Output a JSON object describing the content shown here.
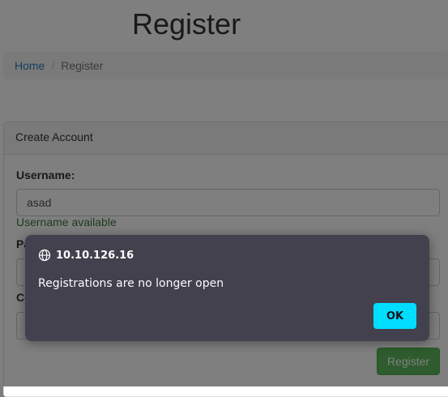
{
  "page": {
    "title": "Register",
    "breadcrumb": {
      "home": "Home",
      "separator": "/",
      "current": "Register"
    }
  },
  "panel": {
    "heading": "Create Account",
    "username_label": "Username:",
    "username_value": "asad",
    "username_help": "Username available",
    "password_label": "Pa",
    "confirm_label": "Co",
    "submit_label": "Register"
  },
  "dialog": {
    "origin": "10.10.126.16",
    "origin_icon": "globe-icon",
    "message": "Registrations are no longer open",
    "ok_label": "OK"
  },
  "colors": {
    "dialog_bg": "#42414d",
    "ok_button": "#00ddff",
    "help_success": "#3c763d",
    "link": "#337ab7"
  }
}
